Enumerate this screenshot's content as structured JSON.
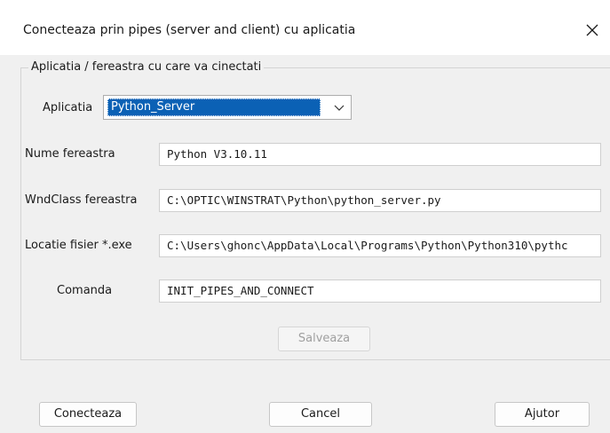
{
  "window": {
    "title": "Conecteaza prin pipes (server and client) cu aplicatia",
    "close_icon": "close-icon"
  },
  "group": {
    "legend": "Aplicatia / fereastra cu care va cinectati"
  },
  "form": {
    "aplicatia_label": "Aplicatia",
    "aplicatia_value": "Python_Server",
    "nume_label": "Nume fereastra",
    "nume_value": "Python V3.10.11",
    "wndclass_label": "WndClass fereastra",
    "wndclass_value": "C:\\OPTIC\\WINSTRAT\\Python\\python_server.py",
    "locatie_label": "Locatie fisier *.exe",
    "locatie_value": "C:\\Users\\ghonc\\AppData\\Local\\Programs\\Python\\Python310\\pythc",
    "comanda_label": "Comanda",
    "comanda_value": "INIT_PIPES_AND_CONNECT",
    "save_label": "Salveaza"
  },
  "footer": {
    "connect_label": "Conecteaza",
    "cancel_label": "Cancel",
    "help_label": "Ajutor"
  },
  "colors": {
    "selection": "#0b61b5",
    "background": "#f0f0f0"
  }
}
